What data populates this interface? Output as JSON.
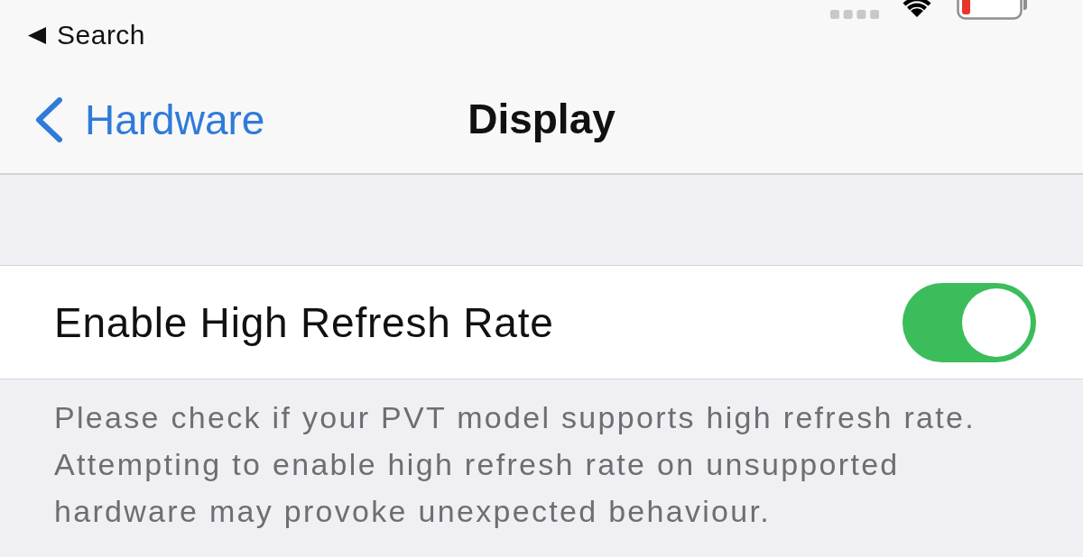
{
  "status_bar": {
    "back_to_app": "Search"
  },
  "nav_bar": {
    "back_label": "Hardware",
    "title": "Display"
  },
  "settings": [
    {
      "kind": "toggle",
      "label": "Enable High Refresh Rate",
      "on": true
    }
  ],
  "footer": "Please check if your PVT model supports high refresh rate. Attempting to enable high refresh rate on unsupported hardware may provoke unexpected behaviour."
}
